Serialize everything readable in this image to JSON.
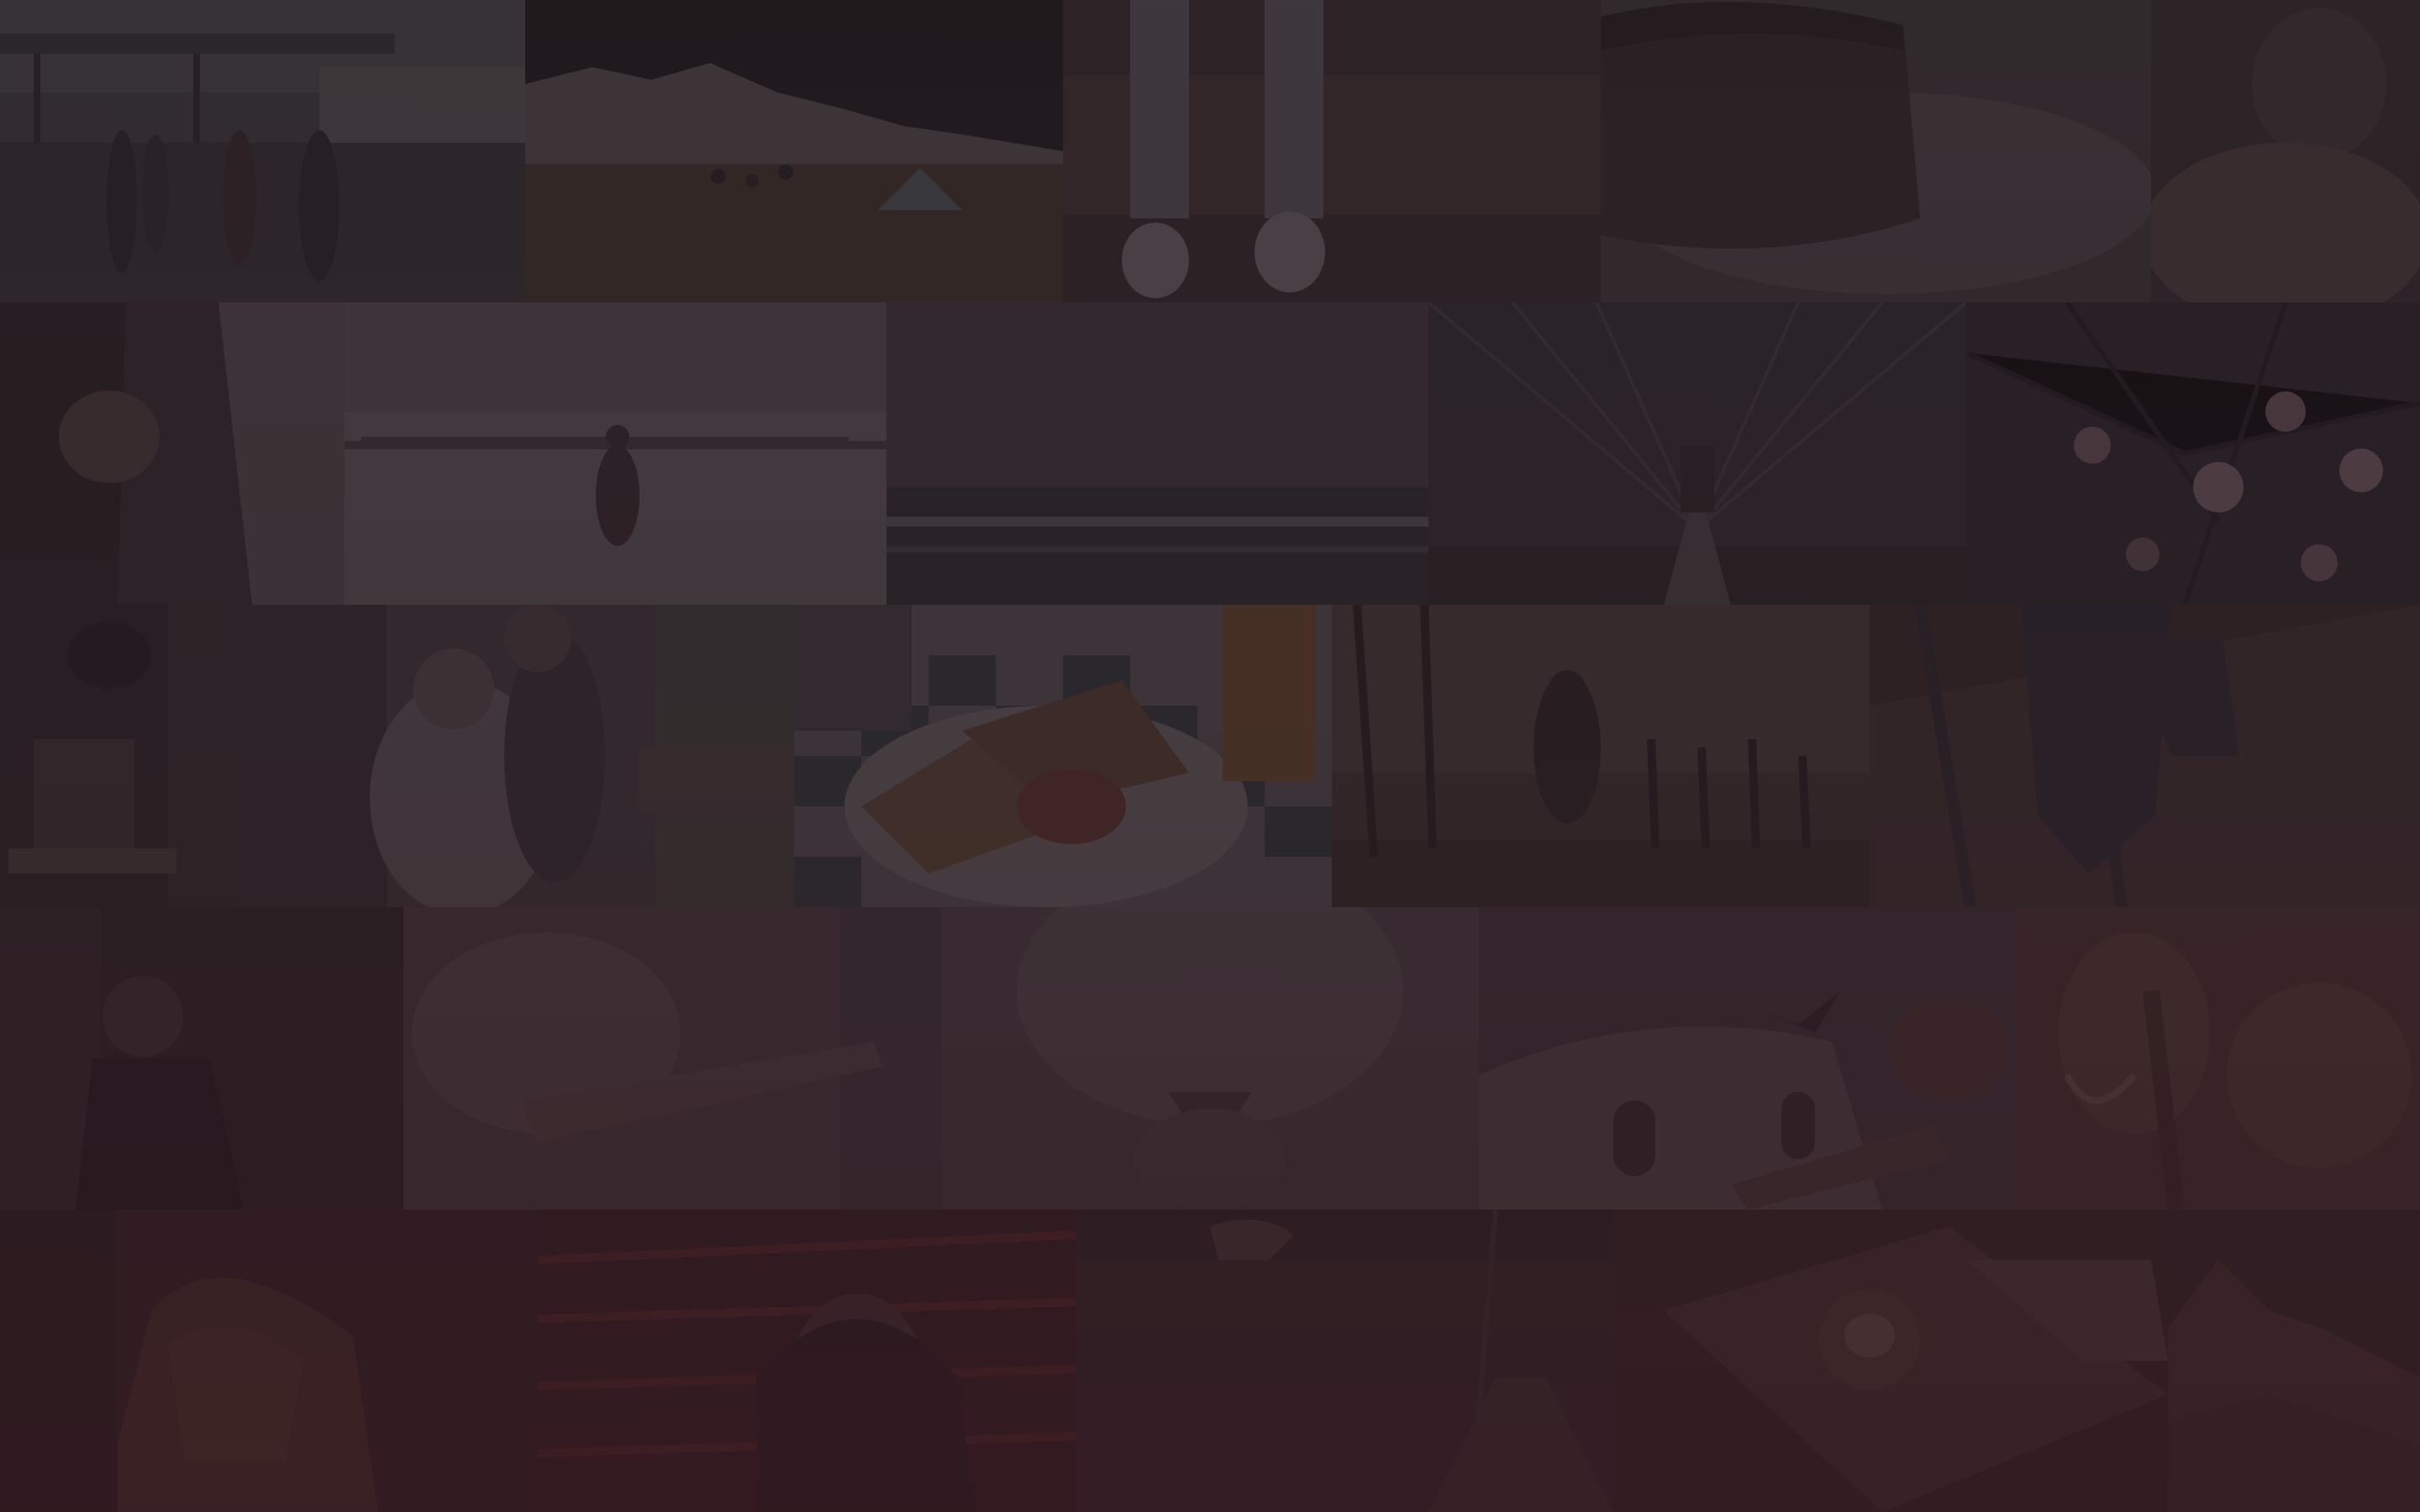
{
  "screen": {
    "description_kind": "dimmed photo mosaic background",
    "overlay_color": "#2a1f25"
  },
  "mosaic": {
    "rows": [
      {
        "tiles": [
          {
            "subject": "gas-station-walkers",
            "palette": [
              "#58575a",
              "#3e3d40",
              "#6a6a6e"
            ]
          },
          {
            "subject": "torn-paper-beach",
            "palette": [
              "#1d191c",
              "#5b4a3a",
              "#7a6b5e"
            ]
          },
          {
            "subject": "sneakers-on-steps",
            "palette": [
              "#4a3c3f",
              "#6e6466",
              "#8a8488"
            ]
          },
          {
            "subject": "chocolate-cake",
            "palette": [
              "#3a2c2e",
              "#4b3a38",
              "#5e5458"
            ]
          },
          {
            "subject": "pug-in-blanket",
            "palette": [
              "#46393c",
              "#6a5a5a",
              "#4a4144"
            ]
          }
        ]
      },
      {
        "tiles": [
          {
            "subject": "hand-with-ring",
            "palette": [
              "#2a2326",
              "#4a3c3e",
              "#7a6c70"
            ]
          },
          {
            "subject": "snowy-pier-walker",
            "palette": [
              "#7a7478",
              "#8f898d",
              "#3a2c30"
            ]
          },
          {
            "subject": "ocean-wave",
            "palette": [
              "#5a4b55",
              "#2f3438",
              "#6b6e74"
            ]
          },
          {
            "subject": "brooklyn-bridge",
            "palette": [
              "#333034",
              "#4a4548",
              "#252226"
            ]
          },
          {
            "subject": "cherry-blossoms",
            "palette": [
              "#2e2a30",
              "#6a5a60",
              "#9a7e84"
            ]
          }
        ]
      },
      {
        "tiles": [
          {
            "subject": "coffee-pour",
            "palette": [
              "#2c2426",
              "#4a3c3c",
              "#6a5c5a"
            ]
          },
          {
            "subject": "bride-and-groom",
            "palette": [
              "#5a5054",
              "#7a7074",
              "#3c3a36"
            ]
          },
          {
            "subject": "grilled-cheese-tomato-soup",
            "palette": [
              "#6d5a4c",
              "#8a8a8a",
              "#7a3b2e"
            ]
          },
          {
            "subject": "skateboarder-palms",
            "palette": [
              "#4a3c38",
              "#2a2222",
              "#6a5a4c"
            ]
          },
          {
            "subject": "boots-on-deck",
            "palette": [
              "#3a2c2a",
              "#4a3a36",
              "#2c2a30"
            ]
          }
        ]
      },
      {
        "tiles": [
          {
            "subject": "woman-portrait",
            "palette": [
              "#2e2428",
              "#4a3c40",
              "#1e181c"
            ]
          },
          {
            "subject": "tattooed-woman",
            "palette": [
              "#5a4a50",
              "#6e5e62",
              "#3a3036"
            ]
          },
          {
            "subject": "cat-closeup",
            "palette": [
              "#5a5056",
              "#6e6468",
              "#4a3e42"
            ]
          },
          {
            "subject": "dome-with-bird",
            "palette": [
              "#4e3e46",
              "#6e5e60",
              "#3a2e36"
            ]
          },
          {
            "subject": "elephant",
            "palette": [
              "#5a3c36",
              "#6e4a40",
              "#4a302c"
            ]
          }
        ]
      },
      {
        "tiles": [
          {
            "subject": "sandwich",
            "palette": [
              "#3a2226",
              "#5a3830",
              "#2a1c20"
            ]
          },
          {
            "subject": "woman-red-lights",
            "palette": [
              "#3a1c22",
              "#6a2a2a",
              "#4a2a2e"
            ]
          },
          {
            "subject": "lake-rowboat",
            "palette": [
              "#3a2c30",
              "#4a3a3c",
              "#2e2428"
            ]
          },
          {
            "subject": "latte-art-tray",
            "palette": [
              "#3c2a2a",
              "#5a3e36",
              "#4a3430"
            ]
          },
          {
            "subject": "mountain-ridge",
            "palette": [
              "#3a2a2c",
              "#5a3e38",
              "#4a3a3a"
            ]
          }
        ]
      }
    ]
  }
}
